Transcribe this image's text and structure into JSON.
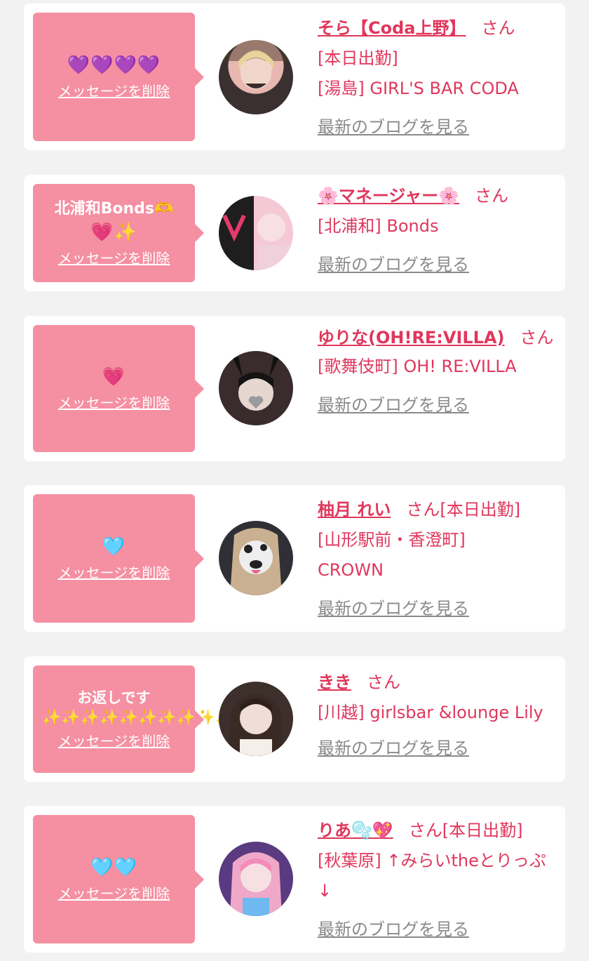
{
  "cards": [
    {
      "message": "",
      "hearts": "💜💜💜💜",
      "delete_label": "メッセージを削除",
      "name": "そら【Coda上野】",
      "san": "さん",
      "status": "[本日出勤]",
      "shop": "[湯島] GIRL'S BAR CODA",
      "blog_label": "最新のブログを見る",
      "avatar_colors": [
        "#2a2a2a",
        "#d8b8a8"
      ]
    },
    {
      "message": "北浦和Bonds🫶",
      "hearts": "💗✨",
      "delete_label": "メッセージを削除",
      "name": "🌸マネージャー🌸",
      "san": "さん",
      "status": "",
      "shop": "[北浦和] Bonds",
      "blog_label": "最新のブログを見る",
      "avatar_colors": [
        "#f3c8d6",
        "#1d1d1d"
      ]
    },
    {
      "message": "",
      "hearts": "💗",
      "delete_label": "メッセージを削除",
      "name": "ゆりな(OH!RE:VILLA)",
      "san": "さん",
      "status": "",
      "shop": "[歌舞伎町] OH! RE:VILLA",
      "blog_label": "最新のブログを見る",
      "avatar_colors": [
        "#3a2c2c",
        "#e2d2cc"
      ]
    },
    {
      "message": "",
      "hearts": "🩵",
      "delete_label": "メッセージを削除",
      "name": "柚月 れい",
      "san": "さん",
      "status": "[本日出勤]",
      "shop": "[山形駅前・香澄町] CROWN",
      "blog_label": "最新のブログを見る",
      "avatar_colors": [
        "#2f2f35",
        "#d8c2c8"
      ]
    },
    {
      "message": "お返しです",
      "hearts": "✨✨✨✨✨✨✨✨✨✨",
      "delete_label": "メッセージを削除",
      "name": "きき",
      "san": "さん",
      "status": "",
      "shop": "[川越] girlsbar &lounge Lily",
      "blog_label": "最新のブログを見る",
      "avatar_colors": [
        "#3c2f2c",
        "#e8d6cf"
      ]
    },
    {
      "message": "",
      "hearts": "🩵🩵",
      "delete_label": "メッセージを削除",
      "name": "りあ🫧💖",
      "san": "さん",
      "status": "[本日出勤]",
      "shop": "[秋葉原] ↑みらいtheとりっぷ↓",
      "blog_label": "最新のブログを見る",
      "avatar_colors": [
        "#7a4aa8",
        "#f2a6c6"
      ]
    }
  ]
}
